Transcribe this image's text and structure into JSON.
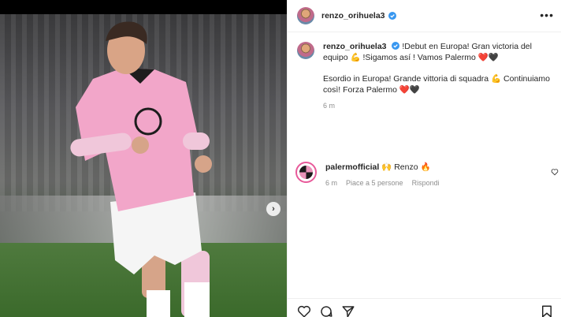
{
  "post": {
    "author": {
      "username": "renzo_orihuela3",
      "verified": true
    },
    "more_label": "•••",
    "caption": {
      "line_es": "!Debut en Europa! Gran victoria del equipo 💪 !Sigamos así ! Vamos Palermo ❤️🖤",
      "line_it": "Esordio in Europa! Grande vittoria di squadra 💪 Continuiamo così! Forza Palermo ❤️🖤",
      "time": "6 m"
    },
    "comments": [
      {
        "username": "palermofficial",
        "text": "🙌 Renzo 🔥",
        "time": "6 m",
        "likes": "Piace a 5 persone",
        "reply_label": "Rispondi"
      }
    ],
    "media": {
      "next_icon": "chevron-right-icon"
    }
  },
  "icons": {
    "like": "heart-icon",
    "comment": "comment-icon",
    "share": "share-icon",
    "save": "bookmark-icon"
  },
  "colors": {
    "verified": "#3897f0",
    "meta_text": "#8e8e8e",
    "text": "#262626",
    "divider": "#efefef",
    "club_ring": "#e85a9a"
  }
}
